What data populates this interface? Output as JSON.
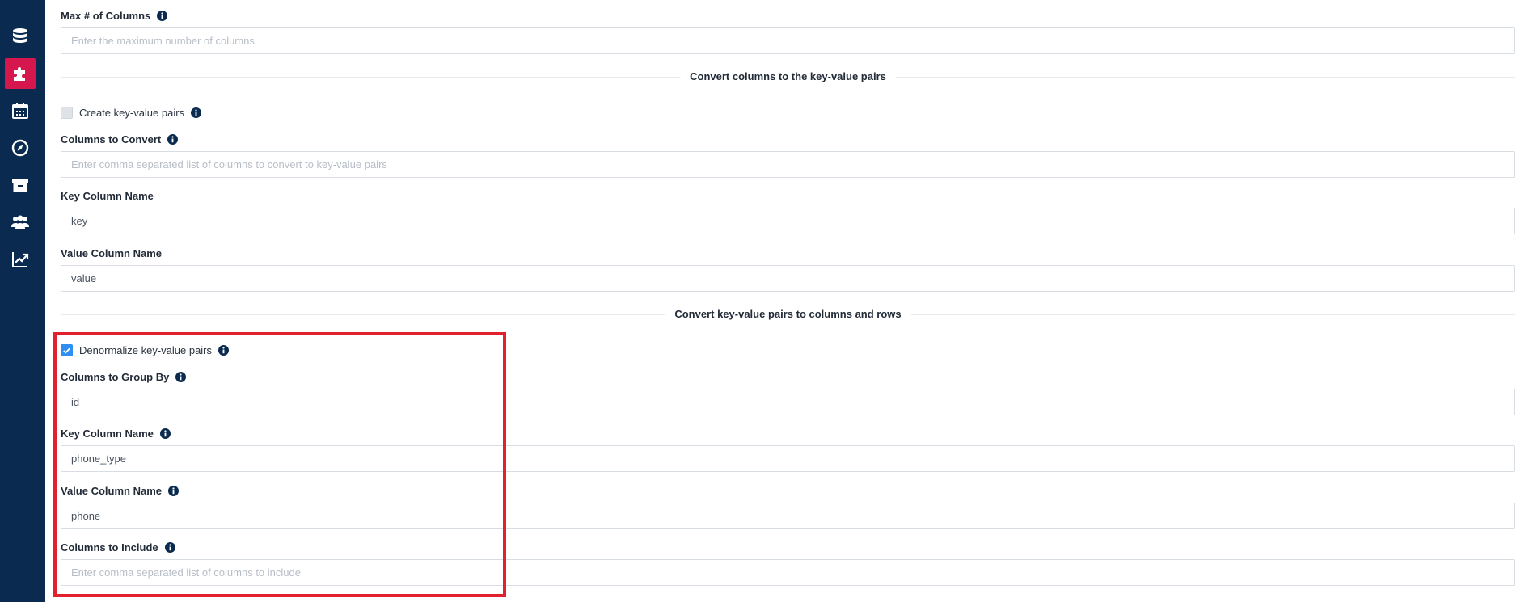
{
  "sidebar": {
    "items": [
      {
        "icon": "database-icon",
        "active": false
      },
      {
        "icon": "puzzle-icon",
        "active": true
      },
      {
        "icon": "calendar-icon",
        "active": false
      },
      {
        "icon": "compass-icon",
        "active": false
      },
      {
        "icon": "archive-icon",
        "active": false
      },
      {
        "icon": "users-icon",
        "active": false
      },
      {
        "icon": "chart-line-icon",
        "active": false
      }
    ],
    "accent_color": "#d6174d",
    "background_color": "#0a2a4f"
  },
  "form": {
    "max_columns": {
      "label": "Max # of Columns",
      "placeholder": "Enter the maximum number of columns",
      "value": ""
    },
    "section_to_kv": {
      "title": "Convert columns to the key-value pairs"
    },
    "create_kv": {
      "label": "Create key-value pairs",
      "checked": false
    },
    "columns_to_convert": {
      "label": "Columns to Convert",
      "placeholder": "Enter comma separated list of columns to convert to key-value pairs",
      "value": ""
    },
    "key_column_name_1": {
      "label": "Key Column Name",
      "value": "key"
    },
    "value_column_name_1": {
      "label": "Value Column Name",
      "value": "value"
    },
    "section_from_kv": {
      "title": "Convert key-value pairs to columns and rows"
    },
    "denormalize_kv": {
      "label": "Denormalize key-value pairs",
      "checked": true
    },
    "columns_group_by": {
      "label": "Columns to Group By",
      "value": "id"
    },
    "key_column_name_2": {
      "label": "Key Column Name",
      "value": "phone_type"
    },
    "value_column_name_2": {
      "label": "Value Column Name",
      "value": "phone"
    },
    "columns_to_include": {
      "label": "Columns to Include",
      "placeholder": "Enter comma separated list of columns to include",
      "value": ""
    }
  },
  "colors": {
    "highlight": "#e3202e",
    "checkbox_checked": "#2f8ff0",
    "info_icon": "#0a2a4f"
  }
}
